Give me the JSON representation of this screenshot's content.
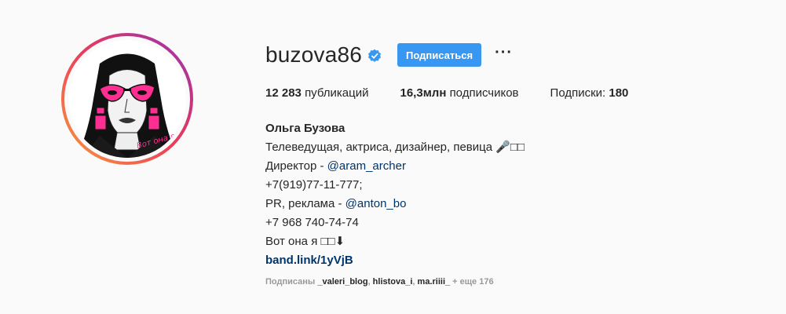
{
  "profile": {
    "username": "buzova86",
    "follow_label": "Подписаться",
    "more_label": "···"
  },
  "stats": {
    "posts_count": "12 283",
    "posts_label": "публикаций",
    "followers_count": "16,3млн",
    "followers_label": "подписчиков",
    "following_label": "Подписки:",
    "following_count": "180"
  },
  "bio": {
    "name": "Ольга Бузова",
    "line1": "Телеведущая, актриса, дизайнер, певица 🎤□□",
    "line2_prefix": "Директор - ",
    "line2_mention": "@aram_archer",
    "line3": "+7(919)77-11-777;",
    "line4_prefix": "PR, реклама - ",
    "line4_mention": "@anton_bo",
    "line5": "+7 968 740-74-74",
    "line6": "Вот она я □□⬇",
    "link": "band.link/1yVjB"
  },
  "followed_by": {
    "prefix": "Подписаны ",
    "accounts": [
      "_valeri_blog",
      "hlistova_i",
      "ma.riiii_"
    ],
    "suffix": " + еще 176"
  },
  "avatar": {
    "caption": "Вот она я"
  },
  "colors": {
    "accent": "#3897f0",
    "link": "#003569",
    "ring_start": "#f5a03a",
    "ring_end": "#c13584"
  }
}
